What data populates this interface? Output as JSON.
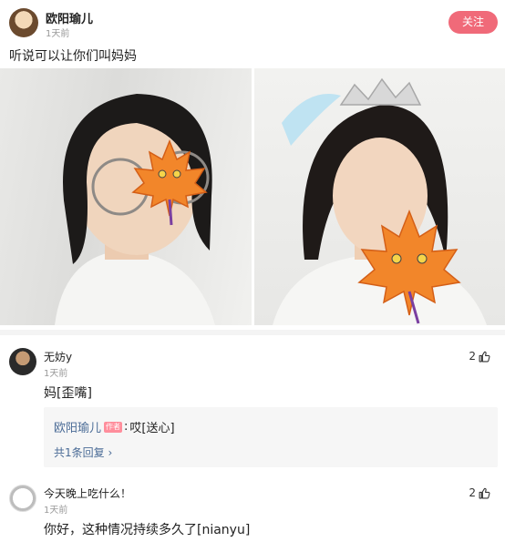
{
  "post": {
    "author": "欧阳瑜儿",
    "time": "1天前",
    "follow_label": "关注",
    "text": "听说可以让你们叫妈妈"
  },
  "comments": [
    {
      "author": "无妨y",
      "time": "1天前",
      "likes": "2",
      "text": "妈[歪嘴]",
      "reply": {
        "author": "欧阳瑜儿",
        "tag": "作者",
        "separator": ":",
        "text": "哎[送心]",
        "more": "共1条回复",
        "more_chevron": "›"
      }
    },
    {
      "author": "今天晚上吃什么！",
      "time": "1天前",
      "likes": "2",
      "text": "你好，这种情况持续多久了[nianyu]"
    }
  ],
  "colors": {
    "follow": "#f06a79",
    "link": "#4a6b96",
    "author_tag": "#ff8e9c",
    "leaf": "#f2862a"
  },
  "icons": [
    "thumbs-up-icon",
    "maple-leaf-sticker",
    "chevron-right-icon"
  ]
}
